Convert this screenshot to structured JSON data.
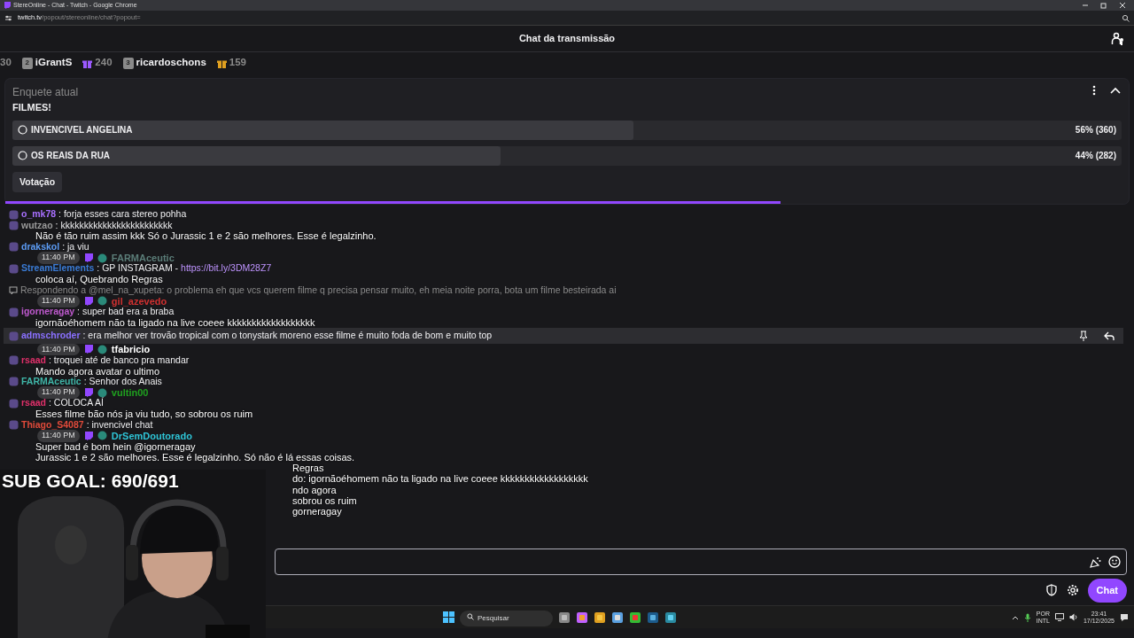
{
  "window": {
    "title": "StereOnline - Chat - Twitch - Google Chrome",
    "url_host": "twitch.tv",
    "url_path": "/popout/stereonline/chat?popout="
  },
  "header": {
    "title": "Chat da transmissão"
  },
  "leaderboard": [
    {
      "kind": "count",
      "text": "30"
    },
    {
      "kind": "user",
      "rank": "2",
      "name": "iGrantS"
    },
    {
      "kind": "gift",
      "color": "#9b59ff",
      "count": "240"
    },
    {
      "kind": "user",
      "rank": "3",
      "name": "ricardoschons"
    },
    {
      "kind": "gift",
      "color": "#e0a020",
      "count": "159"
    }
  ],
  "poll": {
    "label": "Enquete atual",
    "title": "FILMES!",
    "button": "Votação",
    "level": 0.69,
    "options": [
      {
        "label": "INVENCIVEL ANGELINA",
        "result": "56% (360)",
        "level": 0.56,
        "selected": false
      },
      {
        "label": "OS REAIS DA RUA",
        "result": "44% (282)",
        "level": 0.44,
        "selected": false
      }
    ]
  },
  "chat_lines": [
    {
      "kind": "message",
      "user": "o_mk78",
      "color": "#a970ff",
      "text": ": forja esses cara stereo pohha",
      "highlighted": false
    },
    {
      "kind": "message",
      "user": "wutzao",
      "color": "#9a9a9a",
      "text": ": kkkkkkkkkkkkkkkkkkkkkkkk",
      "highlighted": false
    },
    {
      "kind": "overlay",
      "text": "Não é tão ruim assim kkk Só o Jurassic 1 e 2 são melhores. Esse é legalzinho."
    },
    {
      "kind": "message",
      "user": "drakskol",
      "color": "#5c9cf5",
      "text": ": ja viu",
      "highlighted": false
    },
    {
      "kind": "timestamp",
      "time": "11:40 PM",
      "user": "FARMAceutic",
      "color": "#5b7d78"
    },
    {
      "kind": "message",
      "user": "StreamElements",
      "color": "#3a7bd5",
      "text": ": GP INSTAGRAM - ",
      "link": "https://bit.ly/3DM28Z7",
      "highlighted": false
    },
    {
      "kind": "overlay",
      "text": "coloca aí, Quebrando Regras"
    },
    {
      "kind": "reply",
      "text": "Respondendo a @mel_na_xupeta: o problema eh que vcs querem filme q precisa pensar muito, eh meia noite porra, bota um filme besteirada ai"
    },
    {
      "kind": "timestamp",
      "time": "11:40 PM",
      "user": "gil_azevedo",
      "color": "#d03030"
    },
    {
      "kind": "message",
      "user": "igorneragay",
      "color": "#c05ad0",
      "text": ": super bad era a braba",
      "highlighted": false
    },
    {
      "kind": "overlay",
      "text": "igornãoéhomem não ta ligado na live coeee kkkkkkkkkkkkkkkkkk"
    },
    {
      "kind": "message",
      "user": "admschroder",
      "color": "#8a70ff",
      "text": ": era melhor ver trovão tropical com o tonystark moreno esse filme é muito foda de bom e muito top",
      "highlighted": true
    },
    {
      "kind": "timestamp",
      "time": "11:40 PM",
      "user": "tfabricio",
      "color": "#ffffff"
    },
    {
      "kind": "message",
      "user": "rsaad",
      "color": "#e0306a",
      "text": ": troquei até de banco pra mandar",
      "highlighted": false
    },
    {
      "kind": "overlay",
      "text": "Mando agora avatar o ultimo"
    },
    {
      "kind": "message",
      "user": "FARMAceutic",
      "color": "#3fb6a8",
      "text": ": Senhor dos Anais",
      "highlighted": false
    },
    {
      "kind": "timestamp",
      "time": "11:40 PM",
      "user": "vultin00",
      "color": "#1fa01f"
    },
    {
      "kind": "message",
      "user": "rsaad",
      "color": "#e0306a",
      "text": ": COLOCA AÍ",
      "highlighted": false
    },
    {
      "kind": "overlay",
      "text": "Esses filme bão nós ja viu tudo, so sobrou os ruim"
    },
    {
      "kind": "message",
      "user": "Thiago_S4087",
      "color": "#e04a3a",
      "text": ": invencivel chat",
      "highlighted": false
    },
    {
      "kind": "timestamp",
      "time": "11:40 PM",
      "user": "DrSemDoutorado",
      "color": "#2ec4d6"
    },
    {
      "kind": "overlay",
      "text": "Super bad é bom hein @igorneragay"
    },
    {
      "kind": "overlay",
      "text": "Jurassic 1 e 2 são melhores. Esse é legalzinho. Só não é lá essas coisas."
    }
  ],
  "camera_side_lines": [
    {
      "kind": "overlay",
      "text": "Regras"
    },
    {
      "kind": "overlay",
      "text": "do: igornãoéhomem não ta ligado na live coeee kkkkkkkkkkkkkkkkkk"
    },
    {
      "kind": "overlay",
      "text": "ndo agora"
    },
    {
      "kind": "overlay",
      "text": "sobrou os ruim"
    },
    {
      "kind": "overlay",
      "text": "gorneragay"
    }
  ],
  "sub_goal": "SUB GOAL: 690/691",
  "chat_button": "Chat",
  "taskbar": {
    "search_placeholder": "Pesquisar",
    "language": "POR",
    "layout": "INTL",
    "time": "23:41",
    "date": "17/12/2025"
  }
}
